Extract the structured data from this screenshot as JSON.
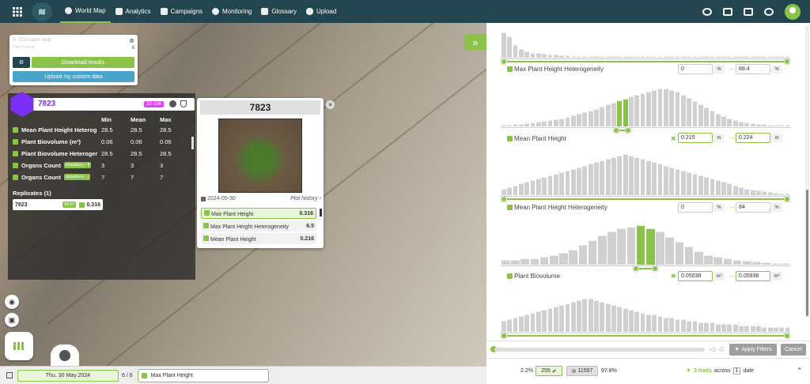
{
  "nav": {
    "items": [
      {
        "label": "World Map",
        "active": true
      },
      {
        "label": "Analytics"
      },
      {
        "label": "Campaigns"
      },
      {
        "label": "Monitoring"
      },
      {
        "label": "Glossary"
      },
      {
        "label": "Upload"
      }
    ]
  },
  "field_card": {
    "title": "3- 2024 open field",
    "subtitle": "Plein champ",
    "count": "6",
    "download_label": "Download results",
    "upload_label": "Upload my custom data"
  },
  "plot": {
    "number": "7823",
    "tag": "22-106",
    "columns": {
      "min": "Min",
      "mean": "Mean",
      "max": "Max"
    },
    "traits": [
      {
        "name": "Mean Plant Height Heterog",
        "min": "28.5",
        "mean": "28.5",
        "max": "28.5",
        "chip": ""
      },
      {
        "name": "Plant Biovolume (m³)",
        "min": "0.06",
        "mean": "0.06",
        "max": "0.06",
        "chip": ""
      },
      {
        "name": "Plant Biovolume Heteroger",
        "min": "28.5",
        "mean": "28.5",
        "max": "28.5",
        "chip": ""
      },
      {
        "name": "Organs Count",
        "min": "3",
        "mean": "3",
        "max": "3",
        "chip": "strawberry - fl"
      },
      {
        "name": "Organs Count",
        "min": "7",
        "mean": "7",
        "max": "7",
        "chip": "strawberry - r"
      }
    ],
    "replicates_label": "Replicates (1)",
    "replicate": {
      "id": "7823",
      "badge": "BEST",
      "value": "0.316"
    }
  },
  "photo": {
    "title": "7823",
    "date": "2024-05-30",
    "history_label": "Plot history",
    "metrics": [
      {
        "label": "Max Plant Height",
        "value": "0.316",
        "selected": true
      },
      {
        "label": "Max Plant Height Heterogeneity",
        "value": "6.5"
      },
      {
        "label": "Mean Plant Height",
        "value": "0.216"
      }
    ]
  },
  "bottom": {
    "date": "Thu. 30 May 2024",
    "page": "6 / 6",
    "trait": "Max Plant Height"
  },
  "filters": [
    {
      "label": "Max Plant Height Heterogeneity",
      "min": "0",
      "min_unit": "%",
      "max": "88.4",
      "max_unit": "%",
      "active": false
    },
    {
      "label": "Mean Plant Height",
      "min": "0.215",
      "min_unit": "m",
      "max": "0.224",
      "max_unit": "m",
      "active": true
    },
    {
      "label": "Mean Plant Height Heterogeneity",
      "min": "0",
      "min_unit": "%",
      "max": "84",
      "max_unit": "%",
      "active": false
    },
    {
      "label": "Plant Biovolume",
      "min": "0.05038",
      "min_unit": "m³",
      "max": "0.05938",
      "max_unit": "m³",
      "active": true
    }
  ],
  "footer": {
    "delta": "+0 -0",
    "apply_label": "Apply Filters",
    "cancel_label": "Cancel",
    "pct_selected": "2.2%",
    "selected_count": "255",
    "excluded_count": "11557",
    "pct_excluded": "97.8%",
    "traits_summary": "3 traits",
    "across": "across",
    "dates": "1",
    "date_word": "date"
  },
  "colors": {
    "accent": "#8bc34a",
    "topbar": "#23454f",
    "plot": "#7b2ff2"
  }
}
